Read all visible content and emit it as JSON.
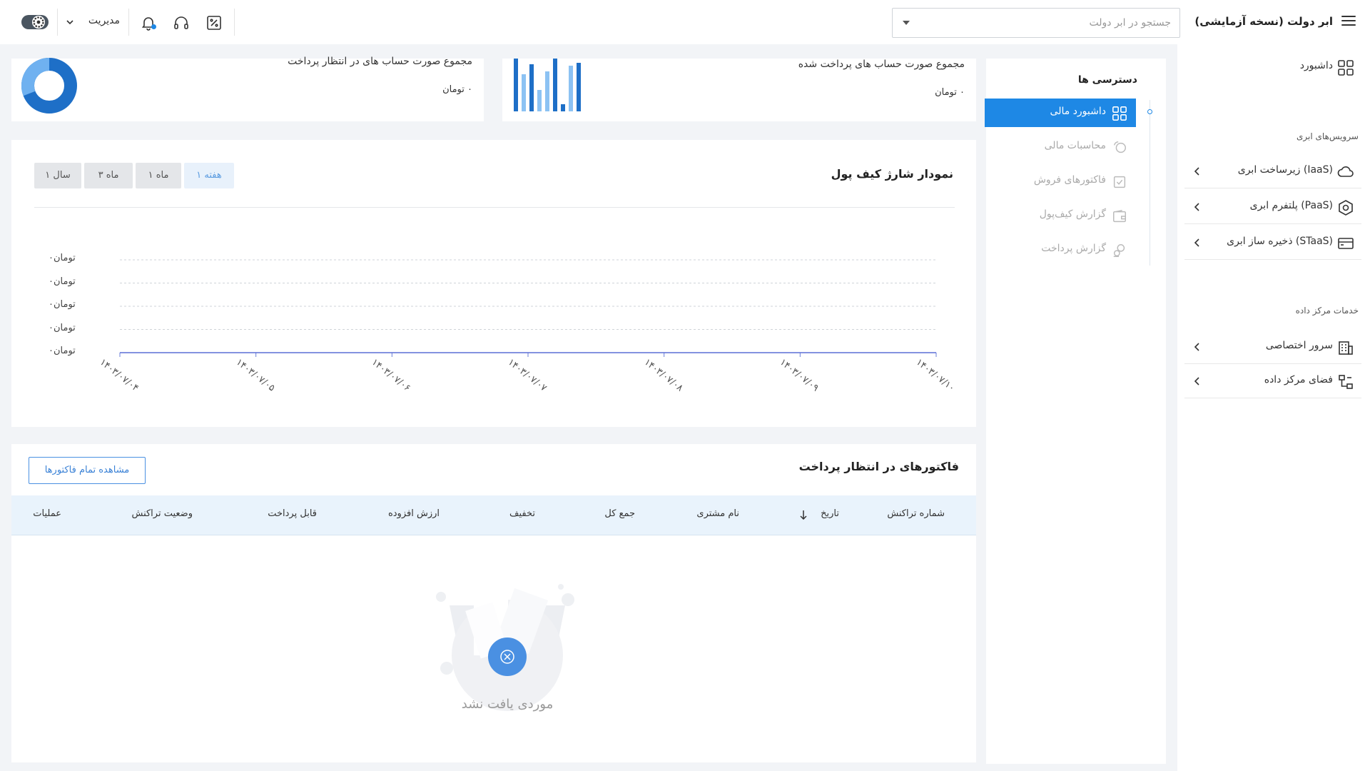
{
  "header": {
    "search_placeholder": "جستجو در ابر دولت",
    "user_menu": "مدیریت"
  },
  "sidebar": {
    "title": "ابر دولت (نسخه آزمایشی)",
    "dashboard": "داشبورد",
    "cloud_section": "سرویس‌های ابری",
    "cloud_items": [
      {
        "label": "زیرساخت ابری (IaaS)"
      },
      {
        "label": "پلتفرم ابری (PaaS)"
      },
      {
        "label": "ذخیره ساز ابری (STaaS)"
      }
    ],
    "dc_section": "خدمات مرکز داده",
    "dc_items": [
      {
        "label": "سرور اختصاصی"
      },
      {
        "label": "فضای مرکز داده"
      }
    ]
  },
  "access": {
    "title": "دسترسی ها",
    "items": [
      {
        "label": "داشبورد مالی",
        "active": true
      },
      {
        "label": "محاسبات مالی"
      },
      {
        "label": "فاکتورهای فروش"
      },
      {
        "label": "گزارش کیف‌پول"
      },
      {
        "label": "گزارش پرداخت"
      }
    ]
  },
  "summary": {
    "paid_title": "مجموع صورت حساب های پرداخت شده",
    "paid_value": "۰",
    "paid_unit": "تومان",
    "pending_title": "مجموع صورت حساب های در انتظار پرداخت",
    "pending_value": "۰",
    "pending_unit": "تومان"
  },
  "wallet_chart": {
    "title": "نمودار شارژ کیف پول",
    "ranges": [
      "۱ هفته",
      "۱ ماه",
      "۳ ماه",
      "۱ سال"
    ],
    "active_range": "۱ هفته"
  },
  "chart_data": {
    "type": "line",
    "x": [
      "۱۴۰۳/۰۷/۰۴",
      "۱۴۰۳/۰۷/۰۵",
      "۱۴۰۳/۰۷/۰۶",
      "۱۴۰۳/۰۷/۰۷",
      "۱۴۰۳/۰۷/۰۸",
      "۱۴۰۳/۰۷/۰۹",
      "۱۴۰۳/۰۷/۱۰"
    ],
    "series": [
      {
        "values": [
          0,
          0,
          0,
          0,
          0,
          0,
          0
        ]
      }
    ],
    "y_ticks": [
      "۰تومان",
      "۰تومان",
      "۰تومان",
      "۰تومان",
      "۰تومان"
    ],
    "grid": true
  },
  "invoices": {
    "title": "فاکتورهای در انتظار پرداخت",
    "view_all": "مشاهده تمام فاکتورها",
    "columns": [
      "شماره تراکنش",
      "تاریخ",
      "نام مشتری",
      "جمع کل",
      "تخفیف",
      "ارزش افزوده",
      "قابل پرداخت",
      "وضعیت تراکنش",
      "عملیات"
    ],
    "empty_text": "موردی یافت نشد"
  },
  "colors": {
    "accent": "#1e88e5",
    "donut_dark": "#1e6fc7",
    "donut_light": "#6fb1f0",
    "bar_light": "#8cc2f3"
  }
}
